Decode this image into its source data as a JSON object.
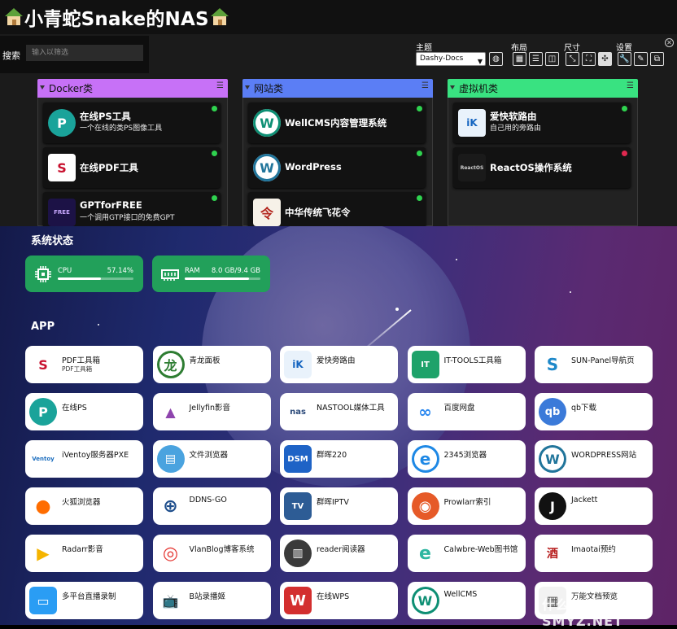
{
  "dashy": {
    "title": "小青蛇Snake的NAS",
    "search": {
      "label": "搜索",
      "placeholder": "输入以筛选"
    },
    "options": {
      "theme_label": "主题",
      "theme_value": "Dashy-Docs",
      "layout_label": "布局",
      "size_label": "尺寸",
      "settings_label": "设置"
    },
    "sections": [
      {
        "name": "Docker类",
        "color": "#c771f7",
        "items": [
          {
            "name": "在线PS工具",
            "desc": "一个在线的类PS图像工具",
            "status": "#2fd24f",
            "icon": "photopea-icon"
          },
          {
            "name": "在线PDF工具",
            "desc": "",
            "status": "#2fd24f",
            "icon": "stirling-pdf-icon"
          },
          {
            "name": "GPTforFREE",
            "desc": "一个调用GTP接口的免费GPT",
            "status": "#2fd24f",
            "icon": "free-gpt-icon"
          }
        ]
      },
      {
        "name": "网站类",
        "color": "#5b7ef5",
        "items": [
          {
            "name": "WellCMS内容管理系统",
            "desc": "",
            "status": "#2fd24f",
            "icon": "wellcms-icon"
          },
          {
            "name": "WordPress",
            "desc": "",
            "status": "#2fd24f",
            "icon": "wordpress-icon"
          },
          {
            "name": "中华传统飞花令",
            "desc": "",
            "status": "#2fd24f",
            "icon": "feihualing-icon"
          }
        ]
      },
      {
        "name": "虚拟机类",
        "color": "#39e281",
        "items": [
          {
            "name": "爱快软路由",
            "desc": "自己用的旁路由",
            "status": "#2fd24f",
            "icon": "ikuai-icon"
          },
          {
            "name": "ReactOS操作系统",
            "desc": "",
            "status": "#e0284f",
            "icon": "reactos-icon"
          }
        ]
      }
    ]
  },
  "sun": {
    "system_title": "系统状态",
    "cpu": {
      "label": "CPU",
      "value": "57.14%",
      "fraction": 0.5714
    },
    "ram": {
      "label": "RAM",
      "value": "8.0 GB/9.4 GB",
      "fraction": 0.85
    },
    "app_title": "APP",
    "apps": [
      {
        "name": "PDF工具箱",
        "desc": "PDF工具箱",
        "icon": "stirling-pdf-icon"
      },
      {
        "name": "青龙面板",
        "desc": "",
        "icon": "qinglong-icon"
      },
      {
        "name": "爱快旁路由",
        "desc": "",
        "icon": "ikuai-icon"
      },
      {
        "name": "IT-TOOLS工具箱",
        "desc": "",
        "icon": "it-tools-icon"
      },
      {
        "name": "SUN-Panel导航页",
        "desc": "",
        "icon": "sun-panel-icon"
      },
      {
        "name": "在线PS",
        "desc": "",
        "icon": "photopea-icon"
      },
      {
        "name": "Jellyfin影音",
        "desc": "",
        "icon": "jellyfin-icon"
      },
      {
        "name": "NASTOOL媒体工具",
        "desc": "",
        "icon": "nastool-icon"
      },
      {
        "name": "百度网盘",
        "desc": "",
        "icon": "baidu-netdisk-icon"
      },
      {
        "name": "qb下载",
        "desc": "",
        "icon": "qbittorrent-icon"
      },
      {
        "name": "iVentoy服务器PXE",
        "desc": "",
        "icon": "ventoy-icon"
      },
      {
        "name": "文件浏览器",
        "desc": "",
        "icon": "file-browser-icon"
      },
      {
        "name": "群晖220",
        "desc": "",
        "icon": "dsm-icon"
      },
      {
        "name": "2345浏览器",
        "desc": "",
        "icon": "browser-2345-icon"
      },
      {
        "name": "WORDPRESS网站",
        "desc": "",
        "icon": "wordpress-icon"
      },
      {
        "name": "火狐浏览器",
        "desc": "",
        "icon": "firefox-icon"
      },
      {
        "name": "DDNS-GO",
        "desc": "",
        "icon": "ddns-go-icon"
      },
      {
        "name": "群晖IPTV",
        "desc": "",
        "icon": "iptv-icon"
      },
      {
        "name": "Prowlarr索引",
        "desc": "",
        "icon": "prowlarr-icon"
      },
      {
        "name": "Jackett",
        "desc": "",
        "icon": "jackett-icon"
      },
      {
        "name": "Radarr影音",
        "desc": "",
        "icon": "radarr-icon"
      },
      {
        "name": "VlanBlog博客系统",
        "desc": "",
        "icon": "vlanblog-icon"
      },
      {
        "name": "reader阅读器",
        "desc": "",
        "icon": "reader-icon"
      },
      {
        "name": "Calwbre-Web图书馆",
        "desc": "",
        "icon": "calibre-web-icon"
      },
      {
        "name": "Imaotai预约",
        "desc": "",
        "icon": "imaotai-icon"
      },
      {
        "name": "多平台直播录制",
        "desc": "",
        "icon": "live-record-icon"
      },
      {
        "name": "B站录播姬",
        "desc": "",
        "icon": "bilibili-tv-icon"
      },
      {
        "name": "在线WPS",
        "desc": "",
        "icon": "wps-icon"
      },
      {
        "name": "WellCMS",
        "desc": "",
        "icon": "wellcms-icon"
      },
      {
        "name": "万能文档预览",
        "desc": "",
        "icon": "doc-preview-icon"
      }
    ],
    "watermark": "什么值得买 SMYZ.NET"
  }
}
